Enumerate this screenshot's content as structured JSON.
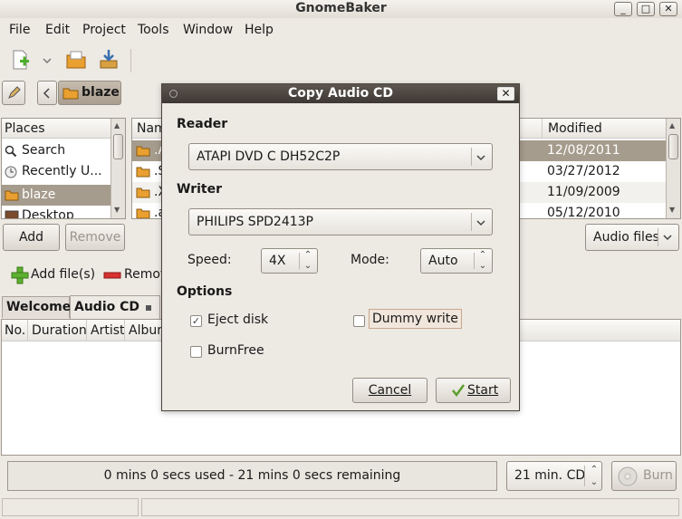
{
  "window": {
    "title": "GnomeBaker",
    "minimize": "_",
    "maximize": "□",
    "close": "✕"
  },
  "menubar": [
    "File",
    "Edit",
    "Project",
    "Tools",
    "Window",
    "Help"
  ],
  "location": {
    "folder": "blaze"
  },
  "places": {
    "header": "Places",
    "items": [
      "Search",
      "Recently U...",
      "blaze",
      "Desktop"
    ]
  },
  "files": {
    "name_header": "Nam",
    "modified_header": "Modified",
    "rows": [
      {
        "name": ".A",
        "modified": "12/08/2011"
      },
      {
        "name": ".S",
        "modified": "03/27/2012"
      },
      {
        "name": ".X",
        "modified": "11/09/2009"
      },
      {
        "name": ".a",
        "modified": "05/12/2010"
      }
    ]
  },
  "buttons": {
    "add": "Add",
    "remove": "Remove",
    "filter": "Audio files"
  },
  "project_toolbar": {
    "add_files": "Add file(s)",
    "remove": "Remov"
  },
  "tabs": [
    "Welcome",
    "Audio CD"
  ],
  "columns": [
    "No.",
    "Duration",
    "Artist",
    "Album"
  ],
  "status": {
    "usage": "0 mins 0 secs used - 21 mins 0 secs remaining",
    "cd_size": "21 min. CD",
    "burn": "Burn"
  },
  "dialog": {
    "title": "Copy Audio CD",
    "reader_label": "Reader",
    "reader_value": "ATAPI DVD C  DH52C2P",
    "writer_label": "Writer",
    "writer_value": "PHILIPS SPD2413P",
    "speed_label": "Speed:",
    "speed_value": "4X",
    "mode_label": "Mode:",
    "mode_value": "Auto",
    "options_label": "Options",
    "eject_disk": "Eject disk",
    "dummy_write": "Dummy write",
    "burnfree": "BurnFree",
    "cancel": "Cancel",
    "start": "Start"
  }
}
